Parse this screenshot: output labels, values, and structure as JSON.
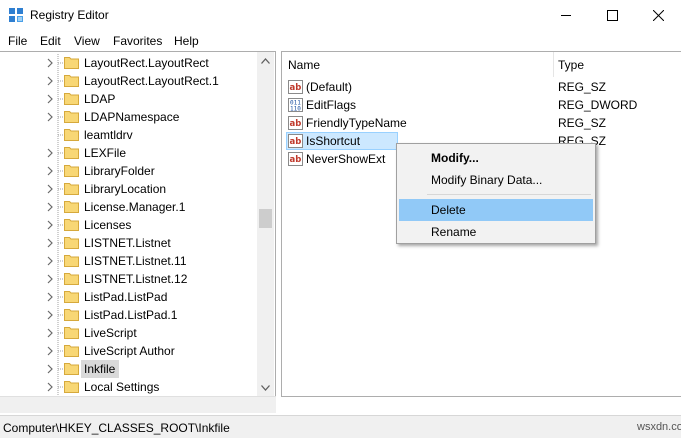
{
  "window": {
    "title": "Registry Editor"
  },
  "menu": [
    "File",
    "Edit",
    "View",
    "Favorites",
    "Help"
  ],
  "tree": {
    "items": [
      {
        "label": "LayoutRect.LayoutRect",
        "expandable": true
      },
      {
        "label": "LayoutRect.LayoutRect.1",
        "expandable": true
      },
      {
        "label": "LDAP",
        "expandable": true
      },
      {
        "label": "LDAPNamespace",
        "expandable": true
      },
      {
        "label": "leamtldrv",
        "expandable": false
      },
      {
        "label": "LEXFile",
        "expandable": true
      },
      {
        "label": "LibraryFolder",
        "expandable": true
      },
      {
        "label": "LibraryLocation",
        "expandable": true
      },
      {
        "label": "License.Manager.1",
        "expandable": true
      },
      {
        "label": "Licenses",
        "expandable": true
      },
      {
        "label": "LISTNET.Listnet",
        "expandable": true
      },
      {
        "label": "LISTNET.Listnet.11",
        "expandable": true
      },
      {
        "label": "LISTNET.Listnet.12",
        "expandable": true
      },
      {
        "label": "ListPad.ListPad",
        "expandable": true
      },
      {
        "label": "ListPad.ListPad.1",
        "expandable": true
      },
      {
        "label": "LiveScript",
        "expandable": true
      },
      {
        "label": "LiveScript Author",
        "expandable": true
      },
      {
        "label": "Inkfile",
        "expandable": true,
        "selected": true
      },
      {
        "label": "Local Settings",
        "expandable": true
      }
    ]
  },
  "values": {
    "columns": {
      "name": "Name",
      "type": "Type"
    },
    "rows": [
      {
        "name": "(Default)",
        "type": "REG_SZ",
        "icon": "string-value-icon"
      },
      {
        "name": "EditFlags",
        "type": "REG_DWORD",
        "icon": "binary-value-icon"
      },
      {
        "name": "FriendlyTypeName",
        "type": "REG_SZ",
        "icon": "string-value-icon"
      },
      {
        "name": "IsShortcut",
        "type": "REG_SZ",
        "icon": "string-value-icon",
        "selected": true
      },
      {
        "name": "NeverShowExt",
        "type": "",
        "icon": "string-value-icon"
      }
    ]
  },
  "context_menu": {
    "items": [
      {
        "label": "Modify...",
        "bold": true
      },
      {
        "label": "Modify Binary Data..."
      },
      {
        "separator": true
      },
      {
        "label": "Delete",
        "hover": true
      },
      {
        "label": "Rename"
      }
    ]
  },
  "status": {
    "path": "Computer\\HKEY_CLASSES_ROOT\\Inkfile",
    "watermark": "wsxdn.com"
  },
  "colors": {
    "selection_blue": "#cce8ff",
    "menu_hover": "#91c9f7",
    "folder_yellow": "#f8d775",
    "tree_selected": "#d9d9d9"
  }
}
